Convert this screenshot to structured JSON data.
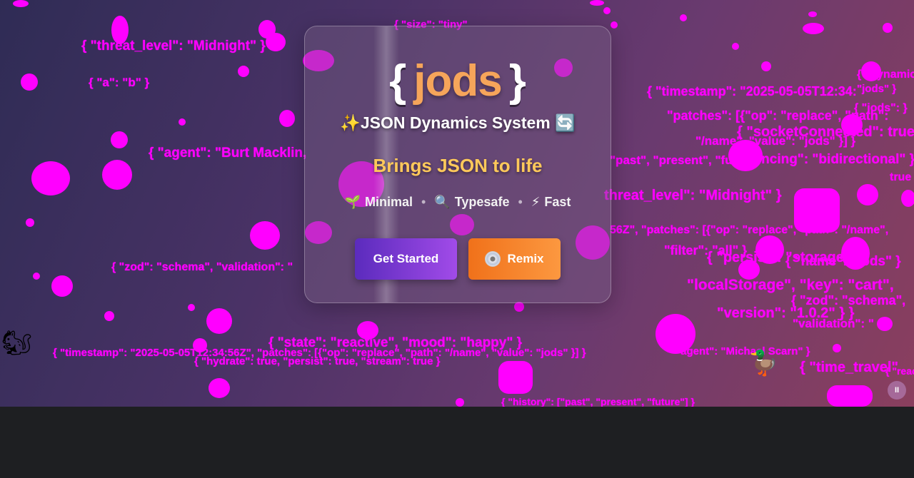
{
  "brand": {
    "brace_open": "{",
    "name": "jods",
    "brace_close": "}",
    "sparkle_icon": "✨",
    "subtitle": "JSON Dynamics System",
    "sync_icon": "🔄",
    "tagline": "Brings JSON to life"
  },
  "features": [
    {
      "icon": "🌱",
      "label": "Minimal"
    },
    {
      "icon": "🔍",
      "label": "Typesafe"
    },
    {
      "icon": "⚡",
      "label": "Fast"
    }
  ],
  "separator": "•",
  "buttons": {
    "get_started": "Get Started",
    "remix": "Remix"
  },
  "pause_icon": "II",
  "critters": {
    "squirrel": "🐿",
    "duck": "🦆"
  },
  "floating_snippets": [
    "{ \"threat_level\": \"Midnight\" }",
    "{ \"a\": \"b\" }",
    "{ \"agent\": \"Burt Macklin,",
    "{ \"timestamp\": \"2025-05-05T12:34:",
    "\"patches\": [{\"op\": \"replace\", \"path\":",
    "\"/name\", \"value\": \"jods\" }] }",
    "{ \"socketConnected\": true,",
    "\"past\", \"present\", \"future\"",
    "\"syncing\": \"bidirectional\" }",
    "threat_level\": \"Midnight\" }",
    "56Z\", \"patches\": [{\"op\": \"replace\", \"path\": \"/name\",",
    "\"filter\": \"all\" }",
    "{ \"persist\": \"storage\"",
    "{ \"name\": \"jods\" }",
    "\"localStorage\", \"key\": \"cart\",",
    "{ \"zod\": \"schema\",",
    "\"version\": \"1.0.2\" } }",
    "\"validation\": \"",
    "{ \"zod\": \"schema\", \"validation\": \"",
    "{ \"state\": \"reactive\", \"mood\": \"happy\" }",
    "{ \"timestamp\": \"2025-05-05T12:34:56Z\", \"patches\": [{\"op\": \"replace\", \"path\": \"/name\", \"value\": \"jods\" }] }",
    "\"agent\": \"Michael Scarn\" }",
    "{ \"hydrate\": true, \"persist\": true, \"stream\": true }",
    "{ \"history\": [\"past\", \"present\", \"future\"] }",
    "{ \"time_travel\"",
    "{ \"jods\": }",
    "{ \"dynamic",
    "\"jods\" }",
    "{ \"size\": \"tiny\"",
    "true }",
    "{ \"react"
  ],
  "colors": {
    "accent_purple": "#7a38d8",
    "accent_orange": "#f7832c",
    "logo_orange": "#f6a55a",
    "tagline_yellow": "#ffc95a",
    "overlay_magenta": "#ff00ff"
  }
}
